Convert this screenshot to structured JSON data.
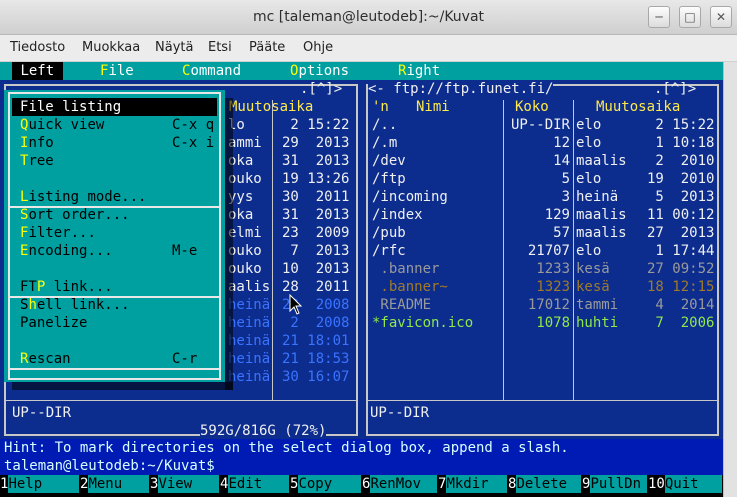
{
  "window": {
    "title": "mc [taleman@leutodeb]:~/Kuvat"
  },
  "menubar": [
    "Tiedosto",
    "Muokkaa",
    "Näytä",
    "Etsi",
    "Pääte",
    "Ohje"
  ],
  "topmenu": {
    "items": [
      {
        "hot": "",
        "rest": "Left",
        "selected": true
      },
      {
        "hot": "F",
        "rest": "ile"
      },
      {
        "hot": "C",
        "rest": "ommand"
      },
      {
        "hot": "O",
        "rest": "ptions"
      },
      {
        "hot": "R",
        "rest": "ight"
      }
    ]
  },
  "dropdown": {
    "items": [
      {
        "hot": "F",
        "rest": "ile listing",
        "shortcut": ""
      },
      {
        "hot": "Q",
        "rest": "uick view",
        "shortcut": "C-x q"
      },
      {
        "hot": "I",
        "rest": "nfo",
        "shortcut": "C-x i"
      },
      {
        "hot": "T",
        "rest": "ree",
        "shortcut": ""
      },
      {
        "hot": "L",
        "rest": "isting mode...",
        "shortcut": ""
      },
      {
        "hot": "S",
        "rest": "ort order...",
        "shortcut": ""
      },
      {
        "hot": "F",
        "rest": "ilter...",
        "shortcut": ""
      },
      {
        "hot": "E",
        "rest": "ncoding...",
        "shortcut": "M-e"
      },
      {
        "pre": "FT",
        "hot": "P",
        "rest": " link...",
        "shortcut": ""
      },
      {
        "pre": "S",
        "hot": "h",
        "rest": "ell link...",
        "shortcut": ""
      },
      {
        "pre": "",
        "hot": "",
        "rest": "Panelize",
        "shortcut": ""
      },
      {
        "hot": "R",
        "rest": "escan",
        "shortcut": "C-r"
      }
    ]
  },
  "left_panel": {
    "top_corner": ".[^]>",
    "header_time": "Muutosaika",
    "rows": [
      {
        "a": "lo",
        "b": " 2 15:22",
        "color": "w"
      },
      {
        "a": "ammi",
        "b": "29  2013",
        "color": "w"
      },
      {
        "a": "oka",
        "b": "31  2013",
        "color": "w"
      },
      {
        "a": "ouko",
        "b": "19 13:26",
        "color": "w"
      },
      {
        "a": "yys",
        "b": "30  2011",
        "color": "w"
      },
      {
        "a": "oka",
        "b": "31  2013",
        "color": "w"
      },
      {
        "a": "elmi",
        "b": "23  2009",
        "color": "w"
      },
      {
        "a": "ouko",
        "b": " 7  2013",
        "color": "w"
      },
      {
        "a": "ouko",
        "b": "10  2013",
        "color": "w"
      },
      {
        "a": "aalis",
        "b": "28  2011",
        "color": "w"
      },
      {
        "a": "heinä",
        "b": "29  2008",
        "color": "blue"
      },
      {
        "a": "heinä",
        "b": " 2  2008",
        "color": "blue"
      },
      {
        "a": "heinä",
        "b": "21 18:01",
        "color": "blue"
      },
      {
        "a": "heinä",
        "b": "21 18:53",
        "color": "blue"
      },
      {
        "a": "heinä",
        "b": "30 16:07",
        "color": "blue"
      }
    ],
    "status": "UP--DIR",
    "free": "592G/816G (72%)"
  },
  "right_panel": {
    "path": "<- ftp://ftp.funet.fi/",
    "top_corner": ".[^]>",
    "headers": {
      "n": "'n",
      "name": "Nimi",
      "size": "Koko",
      "time": "Muutosaika"
    },
    "rows": [
      {
        "name": "/..",
        "size": "UP--DIR",
        "month": "elo",
        "time": " 2 15:22",
        "color": "w"
      },
      {
        "name": "/.m",
        "size": "12",
        "month": "elo",
        "time": " 1 10:18",
        "color": "w"
      },
      {
        "name": "/dev",
        "size": "14",
        "month": "maalis",
        "time": " 2  2010",
        "color": "w"
      },
      {
        "name": "/ftp",
        "size": "5",
        "month": "elo",
        "time": "19  2010",
        "color": "w"
      },
      {
        "name": "/incoming",
        "size": "3",
        "month": "heinä",
        "time": " 5  2013",
        "color": "w"
      },
      {
        "name": "/index",
        "size": "129",
        "month": "maalis",
        "time": "11 00:12",
        "color": "w"
      },
      {
        "name": "/pub",
        "size": "57",
        "month": "maalis",
        "time": "27  2013",
        "color": "w"
      },
      {
        "name": "/rfc",
        "size": "21707",
        "month": "elo",
        "time": " 1 17:44",
        "color": "w"
      },
      {
        "name": " .banner",
        "size": "1233",
        "month": "kesä",
        "time": "27 09:52",
        "color": "g"
      },
      {
        "name": " .banner~",
        "size": "1323",
        "month": "kesä",
        "time": "18 12:15",
        "color": "brown"
      },
      {
        "name": " README",
        "size": "17012",
        "month": "tammi",
        "time": " 4  2014",
        "color": "g"
      },
      {
        "name": "*favicon.ico",
        "size": "1078",
        "month": "huhti",
        "time": " 7  2006",
        "color": "lg"
      }
    ],
    "status": "UP--DIR"
  },
  "hint": "Hint: To mark directories on the select dialog box, append a slash.",
  "prompt": "taleman@leutodeb:~/Kuvat$",
  "fkeys": [
    {
      "n": "1",
      "l": "Help"
    },
    {
      "n": "2",
      "l": "Menu"
    },
    {
      "n": "3",
      "l": "View"
    },
    {
      "n": "4",
      "l": "Edit"
    },
    {
      "n": "5",
      "l": "Copy"
    },
    {
      "n": "6",
      "l": "RenMov"
    },
    {
      "n": "7",
      "l": "Mkdir"
    },
    {
      "n": "8",
      "l": "Delete"
    },
    {
      "n": "9",
      "l": "PullDn"
    },
    {
      "n": "10",
      "l": "Quit"
    }
  ]
}
